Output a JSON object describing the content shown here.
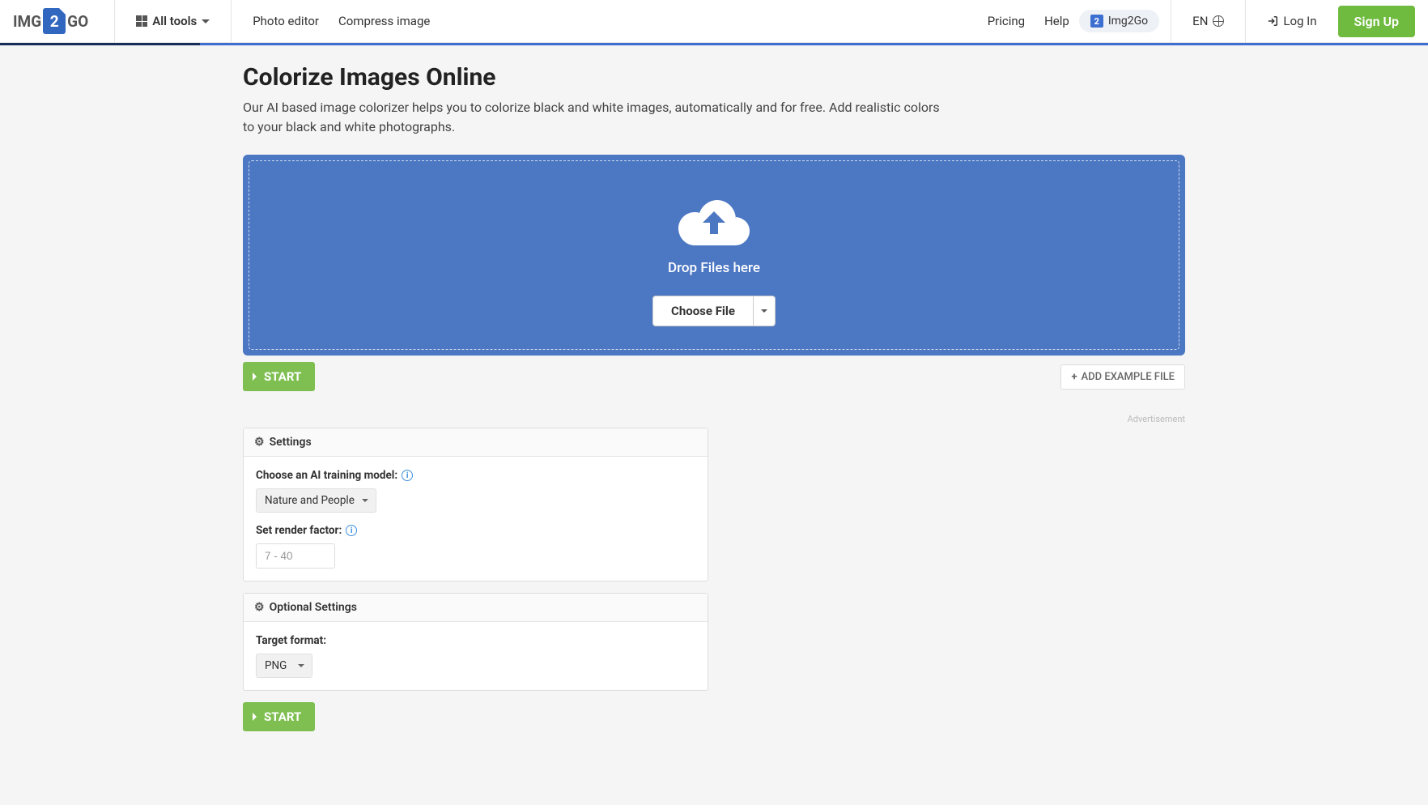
{
  "header": {
    "logo_pre": "IMG",
    "logo_mid": "2",
    "logo_post": "GO",
    "all_tools": "All tools",
    "photo_editor": "Photo editor",
    "compress": "Compress image",
    "pricing": "Pricing",
    "help": "Help",
    "brand_badge": "Img2Go",
    "lang": "EN",
    "login": "Log In",
    "signup": "Sign Up"
  },
  "page": {
    "title": "Colorize Images Online",
    "subtitle": "Our AI based image colorizer helps you to colorize black and white images, automatically and for free. Add realistic colors to your black and white photographs."
  },
  "dropzone": {
    "drop_text": "Drop Files here",
    "choose": "Choose File"
  },
  "actions": {
    "start": "START",
    "add_example": "ADD EXAMPLE FILE"
  },
  "ad_label": "Advertisement",
  "settings": {
    "panel_title": "Settings",
    "model_label": "Choose an AI training model:",
    "model_value": "Nature and People",
    "render_label": "Set render factor:",
    "render_placeholder": "7 - 40"
  },
  "optional": {
    "panel_title": "Optional Settings",
    "target_label": "Target format:",
    "target_value": "PNG"
  }
}
